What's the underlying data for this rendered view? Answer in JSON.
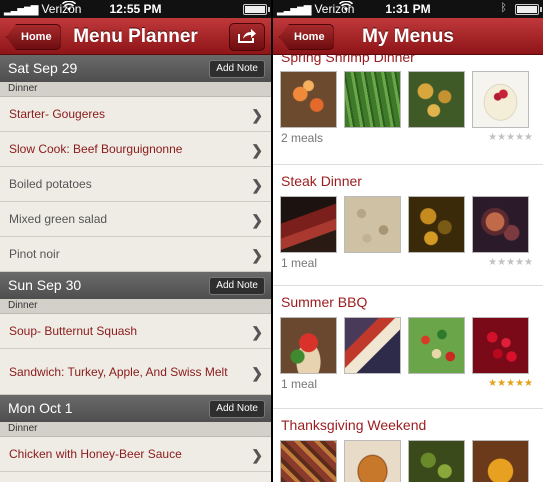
{
  "left": {
    "status": {
      "carrier": "Verizon",
      "time": "12:55 PM"
    },
    "nav": {
      "home_label": "Home",
      "title": "Menu Planner"
    },
    "days": [
      {
        "date": "Sat Sep 29",
        "add_note": "Add Note",
        "meal": "Dinner",
        "items": [
          "Starter- Gougeres",
          "Slow Cook: Beef Bourguignonne",
          "Boiled potatoes",
          "Mixed green salad",
          "Pinot noir"
        ]
      },
      {
        "date": "Sun Sep 30",
        "add_note": "Add Note",
        "meal": "Dinner",
        "items": [
          "Soup- Butternut Squash",
          "Sandwich: Turkey, Apple, And Swiss Melt"
        ]
      },
      {
        "date": "Mon Oct 1",
        "add_note": "Add Note",
        "meal": "Dinner",
        "items": [
          "Chicken with Honey-Beer Sauce"
        ]
      }
    ]
  },
  "right": {
    "status": {
      "carrier": "Verizon",
      "time": "1:31 PM"
    },
    "nav": {
      "home_label": "Home",
      "title": "My Menus"
    },
    "menus": [
      {
        "title": "Spring Shrimp Dinner",
        "count": "2 meals",
        "rating": 0,
        "thumbs": [
          "shrimp",
          "asparagus",
          "potatoes",
          "panna-cotta"
        ]
      },
      {
        "title": "Steak Dinner",
        "count": "1 meal",
        "rating": 0,
        "thumbs": [
          "steak",
          "risotto",
          "brussels-sprouts",
          "figs"
        ]
      },
      {
        "title": "Summer BBQ",
        "count": "1 meal",
        "rating": 5,
        "thumbs": [
          "tomato-salad",
          "grilled-meat",
          "salad",
          "strawberry-tart"
        ]
      },
      {
        "title": "Thanksgiving Weekend",
        "count": "",
        "rating": 0,
        "thumbs": [
          "dish",
          "turkey",
          "green-vegetables",
          "pie"
        ]
      }
    ]
  },
  "colors": {
    "nav_red": "#9b1c1f",
    "accent_text": "#8b1a1c",
    "star_on": "#e3a21a",
    "star_off": "#c2c2c2"
  },
  "icons": {
    "share": "share-icon",
    "chevron": "chevron-right-icon",
    "wifi": "wifi-icon",
    "bluetooth": "bluetooth-icon",
    "battery": "battery-icon",
    "star": "star-icon"
  }
}
